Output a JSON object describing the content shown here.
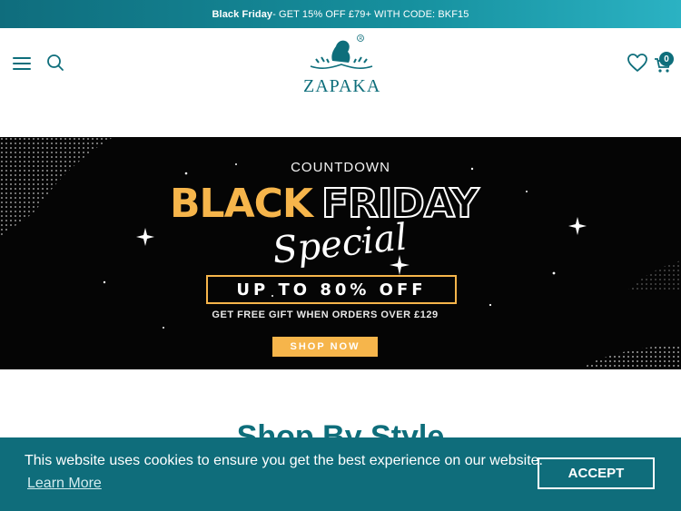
{
  "announcement": {
    "bold": "Black Friday",
    "text": " - GET 15% OFF £79+ WITH CODE: BKF15"
  },
  "header": {
    "brand": "ZAPAKA",
    "cart_count": "0"
  },
  "banner": {
    "countdown": "COUNTDOWN",
    "black": "BLACK",
    "friday": "FRIDAY",
    "special": "Special",
    "offer": "UP TO 80% OFF",
    "gift": "GET FREE GIFT WHEN ORDERS OVER £129",
    "cta": "SHOP NOW",
    "accent_color": "#f6b54b"
  },
  "section": {
    "title": "Shop By Style"
  },
  "cookie": {
    "message": "This website uses cookies to ensure you get the best experience on our website.",
    "learn_more": "Learn More",
    "accept": "ACCEPT"
  },
  "colors": {
    "brand": "#0e6e7b",
    "cookie_bg": "#0f6d7b"
  },
  "icons": [
    "menu-icon",
    "search-icon",
    "heart-icon",
    "cart-icon"
  ]
}
